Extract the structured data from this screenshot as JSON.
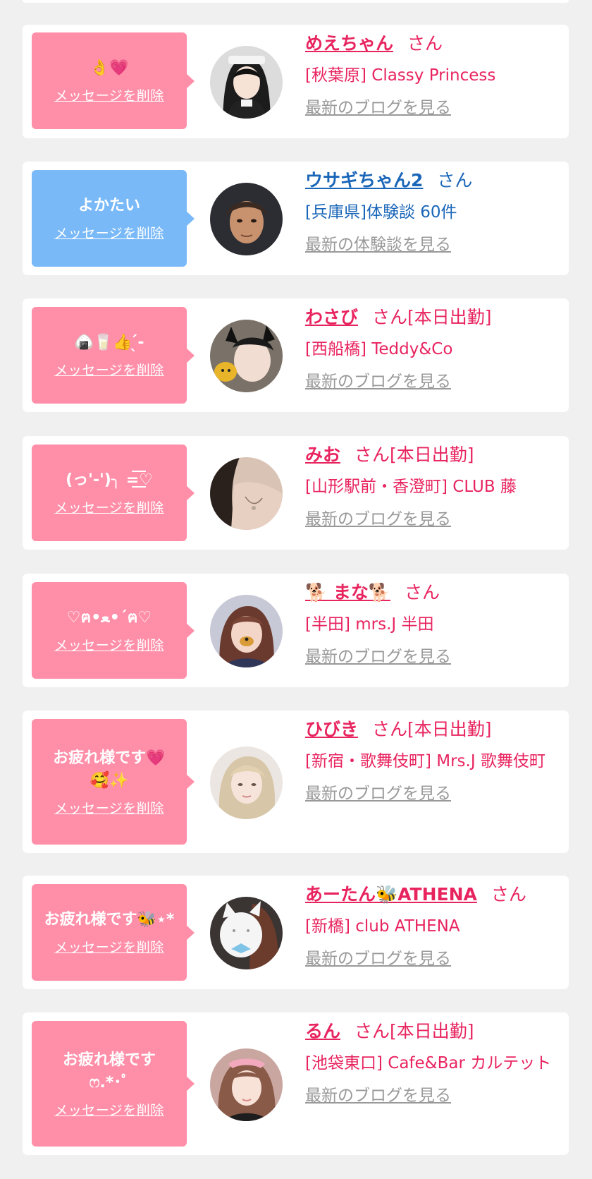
{
  "colors": {
    "pink": "#e8245f",
    "blue": "#1a66b8",
    "bubble_pink": "#ff8fa9",
    "bubble_blue": "#79b9f8",
    "link_gray": "#999999"
  },
  "delete_label": "メッセージを削除",
  "cards": [
    {
      "message": "👌💗",
      "name": "めえちゃん",
      "suffix": "さん",
      "shop": "[秋葉原] Classy Princess",
      "more": "最新のブログを見る",
      "theme": "pink",
      "avatar": "avatar-icon-1"
    },
    {
      "message": "よかたい",
      "name": "ウサギちゃん2",
      "suffix": "さん",
      "shop": "[兵庫県]体験談 60件",
      "more": "最新の体験談を見る",
      "theme": "blue",
      "avatar": "avatar-icon-2"
    },
    {
      "message": "🍙🥛👍 ̖́-",
      "name": "わさび",
      "suffix": "さん[本日出勤]",
      "shop": "[西船橋] Teddy&Co",
      "more": "最新のブログを見る",
      "theme": "pink",
      "avatar": "avatar-icon-3"
    },
    {
      "message": "(っ'-')╮ =͟͟͞͞♡",
      "name": "みお",
      "suffix": "さん[本日出勤]",
      "shop": "[山形駅前・香澄町] CLUB 藤",
      "more": "最新のブログを見る",
      "theme": "pink",
      "avatar": "avatar-icon-4"
    },
    {
      "message": "♡ฅ•ﻌ•´ฅ♡",
      "name": "🐕 まな🐕",
      "suffix": "さん",
      "shop": "[半田] mrs.J 半田",
      "more": "最新のブログを見る",
      "theme": "pink",
      "avatar": "avatar-icon-5"
    },
    {
      "message": "お疲れ様です💗\n🥰✨",
      "name": "ひびき",
      "suffix": "さん[本日出勤]",
      "shop": "[新宿・歌舞伎町] Mrs.J 歌舞伎町",
      "more": "最新のブログを見る",
      "theme": "pink",
      "avatar": "avatar-icon-6"
    },
    {
      "message": "お疲れ様です🐝⋆*",
      "name": "あーたん🐝ATHENA",
      "suffix": "さん",
      "shop": "[新橋] club ATHENA",
      "more": "最新のブログを見る",
      "theme": "pink",
      "avatar": "avatar-icon-7"
    },
    {
      "message": "お疲れ様です\nෆ.*･ﾟ",
      "name": "るん",
      "suffix": "さん[本日出勤]",
      "shop": "[池袋東口] Cafe&Bar カルテット",
      "more": "最新のブログを見る",
      "theme": "pink",
      "avatar": "avatar-icon-8"
    }
  ]
}
